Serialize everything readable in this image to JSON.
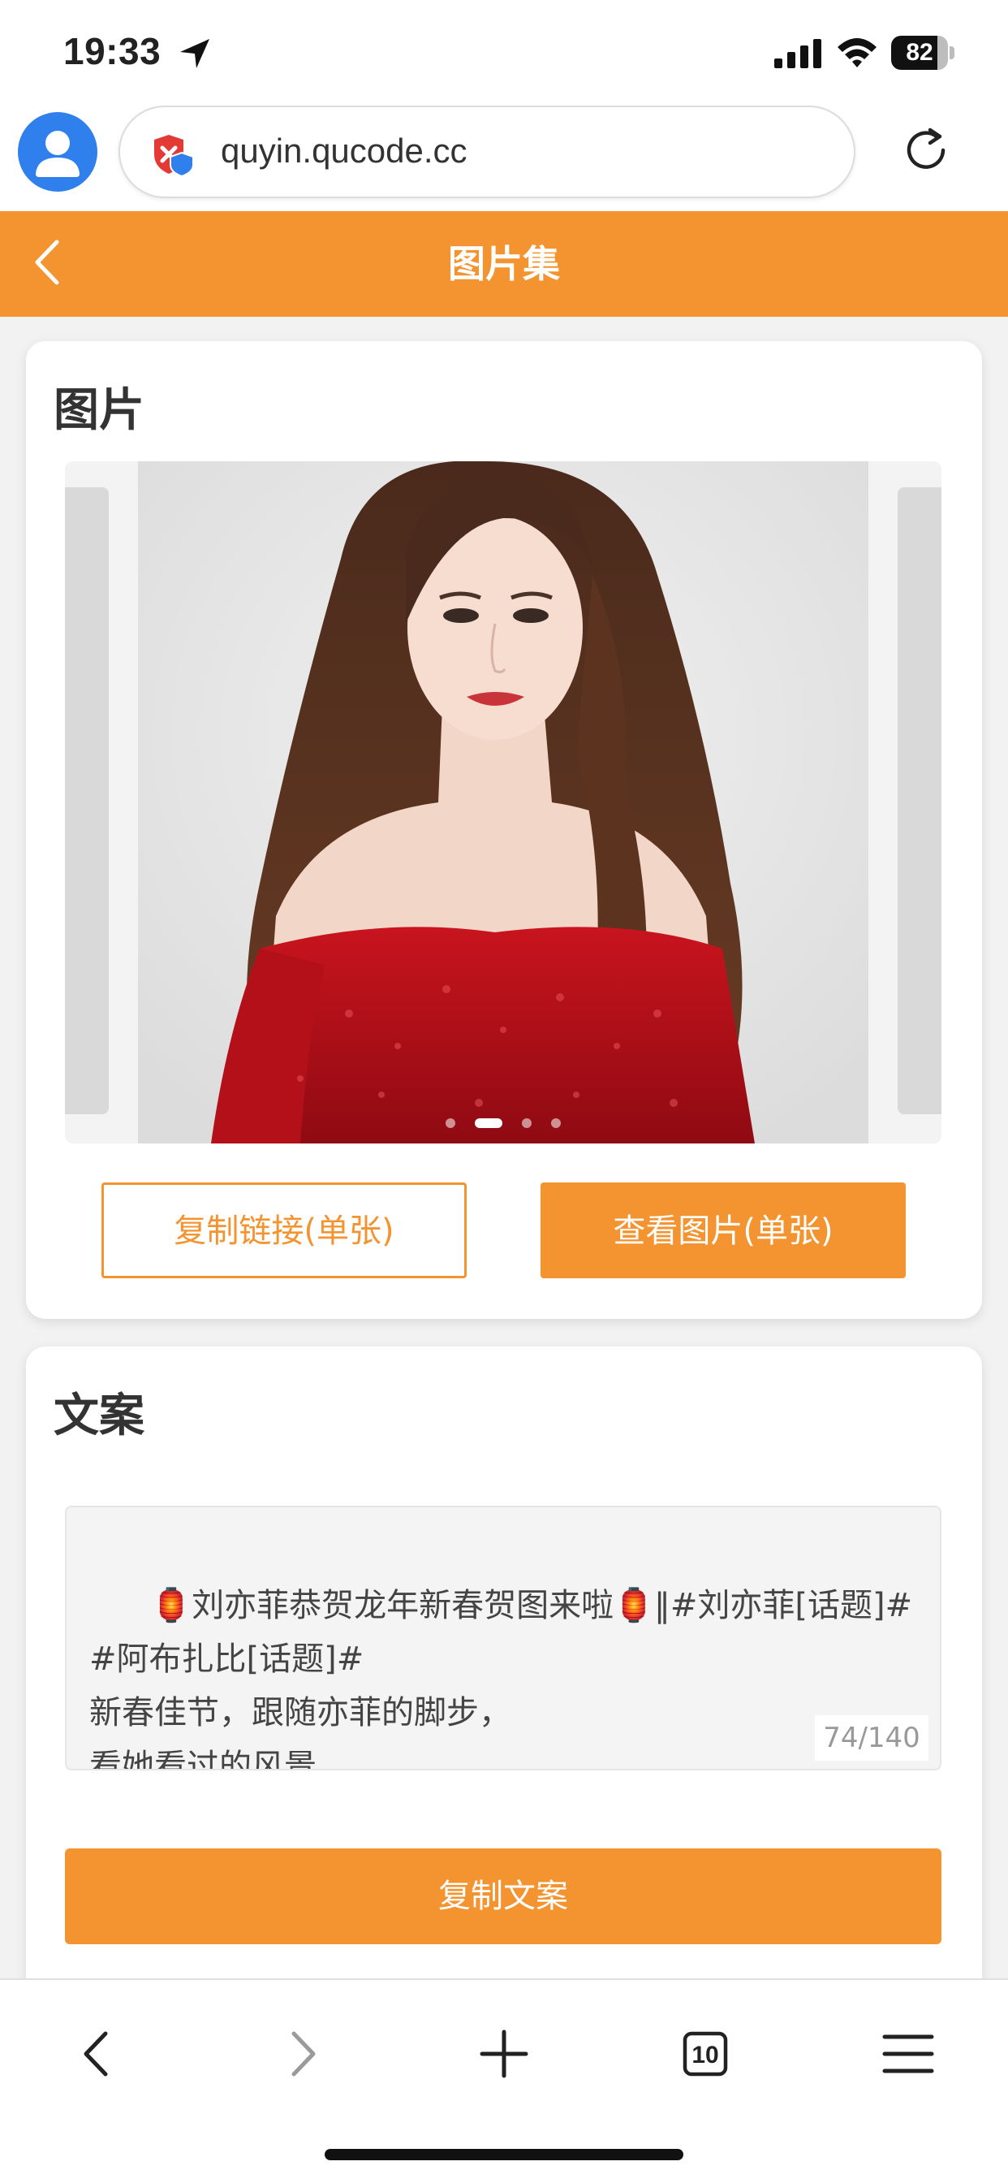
{
  "status_bar": {
    "time": "19:33",
    "battery_percent": "82",
    "battery_level": 0.82
  },
  "browser": {
    "url": "quyin.qucode.cc",
    "tab_count": "10"
  },
  "header": {
    "title": "图片集"
  },
  "images_card": {
    "title": "图片",
    "carousel": {
      "slide_count": 4,
      "active_index": 1
    },
    "copy_link_label": "复制链接(单张)",
    "view_image_label": "查看图片(单张)"
  },
  "text_card": {
    "title": "文案",
    "caption": "🏮刘亦菲恭贺龙年新春贺图来啦🏮‖#刘亦菲[话题]# #阿布扎比[话题]#\n新春佳节，跟随亦菲的脚步，\n看她看过的风景，",
    "counter": "74/140",
    "copy_text_label": "复制文案"
  },
  "colors": {
    "accent": "#f49431",
    "avatar_blue": "#2f80ed",
    "page_bg": "#f2f2f2"
  },
  "icons": {
    "back": "chevron-left-icon",
    "reload": "reload-icon",
    "shield": "shield-icon",
    "toolbar": [
      "back-arrow-icon",
      "forward-arrow-icon",
      "plus-icon",
      "tabs-icon",
      "menu-icon"
    ]
  }
}
